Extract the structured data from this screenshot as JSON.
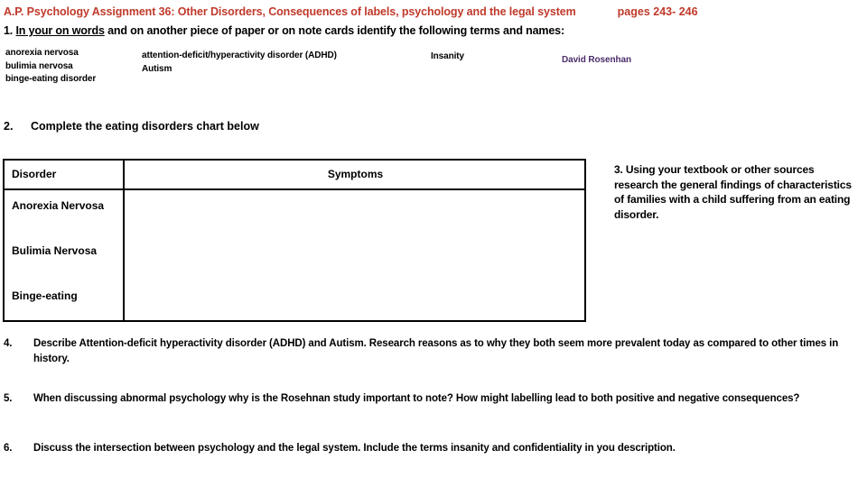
{
  "header": {
    "title": "A.P. Psychology Assignment 36:  Other Disorders, Consequences of labels, psychology and the legal system",
    "pages": "pages 243- 246",
    "title_color": "#C0392B"
  },
  "item1": {
    "number": "1.",
    "underlined_phrase": "In your on words",
    "rest": " and on another piece of paper or on note cards identify the following terms and names:"
  },
  "terms": {
    "column1": [
      "anorexia nervosa",
      "bulimia nervosa",
      "binge-eating disorder"
    ],
    "column2": [
      "attention-deficit/hyperactivity disorder (ADHD)",
      "Autism"
    ],
    "column3": [
      "Insanity"
    ],
    "column4": [
      "David Rosenhan"
    ],
    "column4_color": "#4B2D6B"
  },
  "item2": {
    "number": "2.",
    "text": "Complete the eating disorders chart below"
  },
  "chart_data": {
    "type": "table",
    "title": "Eating disorders chart",
    "columns": [
      "Disorder",
      "Symptoms"
    ],
    "rows": [
      {
        "disorder": "Anorexia Nervosa",
        "symptoms": ""
      },
      {
        "disorder": "Bulimia Nervosa",
        "symptoms": ""
      },
      {
        "disorder": "Binge-eating",
        "symptoms": ""
      }
    ],
    "notes": "Blank worksheet table; symptom cells are empty for student completion."
  },
  "item3": {
    "text": "3.  Using your textbook or other sources research the general findings of characteristics of families with a   child suffering from an eating disorder."
  },
  "questions": [
    {
      "number": "4.",
      "line1": "Describe Attention-deficit hyperactivity disorder (ADHD) and Autism.  Research reasons as to why they both seem more prevalent today as compared to",
      "line2": "other times in history."
    },
    {
      "number": "5.",
      "line1": "When discussing abnormal psychology why is the Rosehnan study important to note?  How might labelling lead to both positive and negative consequences?",
      "line2": ""
    },
    {
      "number": "6.",
      "line1": "Discuss the intersection between psychology and the legal system.  Include the terms insanity and confidentiality in you description.",
      "line2": ""
    }
  ]
}
